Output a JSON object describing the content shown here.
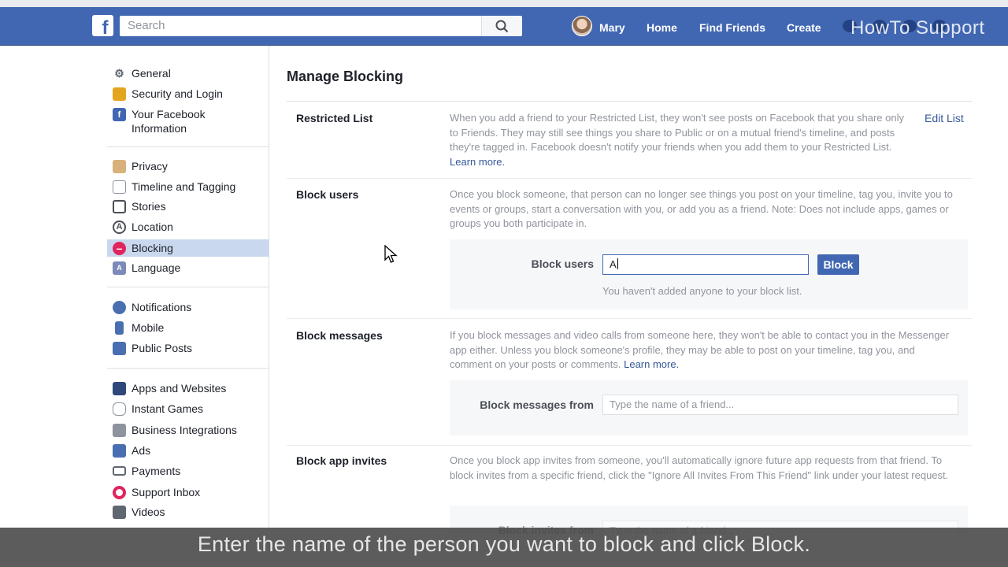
{
  "topnav": {
    "logo": "f",
    "search_placeholder": "Search",
    "user_name": "Mary",
    "links": [
      "Home",
      "Find Friends",
      "Create"
    ],
    "brand_color": "#4267b2"
  },
  "watermark": "HowTo Support",
  "sidebar": {
    "items": [
      {
        "label": "General",
        "icon": "gear-icon"
      },
      {
        "label": "Security and Login",
        "icon": "badge-icon"
      },
      {
        "label": "Your Facebook Information",
        "icon": "facebook-icon"
      },
      {
        "label": "Privacy",
        "icon": "lock-icon"
      },
      {
        "label": "Timeline and Tagging",
        "icon": "timeline-icon"
      },
      {
        "label": "Stories",
        "icon": "book-icon"
      },
      {
        "label": "Location",
        "icon": "location-icon"
      },
      {
        "label": "Blocking",
        "icon": "blocking-icon",
        "active": true
      },
      {
        "label": "Language",
        "icon": "language-icon"
      },
      {
        "label": "Notifications",
        "icon": "globe-icon"
      },
      {
        "label": "Mobile",
        "icon": "mobile-icon"
      },
      {
        "label": "Public Posts",
        "icon": "rss-icon"
      },
      {
        "label": "Apps and Websites",
        "icon": "apps-icon"
      },
      {
        "label": "Instant Games",
        "icon": "gamepad-icon"
      },
      {
        "label": "Business Integrations",
        "icon": "business-icon"
      },
      {
        "label": "Ads",
        "icon": "ads-icon"
      },
      {
        "label": "Payments",
        "icon": "card-icon"
      },
      {
        "label": "Support Inbox",
        "icon": "lifebuoy-icon"
      },
      {
        "label": "Videos",
        "icon": "film-icon"
      }
    ]
  },
  "main": {
    "title": "Manage Blocking",
    "restricted": {
      "label": "Restricted List",
      "desc": "When you add a friend to your Restricted List, they won't see posts on Facebook that you share only to Friends. They may still see things you share to Public or on a mutual friend's timeline, and posts they're tagged in. Facebook doesn't notify your friends when you add them to your Restricted List.",
      "learn_more": "Learn more.",
      "edit": "Edit List"
    },
    "block_users": {
      "label": "Block users",
      "desc": "Once you block someone, that person can no longer see things you post on your timeline, tag you, invite you to events or groups, start a conversation with you, or add you as a friend. Note: Does not include apps, games or groups you both participate in.",
      "field_label": "Block users",
      "input_value": "A",
      "button": "Block",
      "empty_note": "You haven't added anyone to your block list."
    },
    "block_messages": {
      "label": "Block messages",
      "desc": "If you block messages and video calls from someone here, they won't be able to contact you in the Messenger app either. Unless you block someone's profile, they may be able to post on your timeline, tag you, and comment on your posts or comments.",
      "learn_more": "Learn more.",
      "field_label": "Block messages from",
      "placeholder": "Type the name of a friend..."
    },
    "block_app_invites": {
      "label": "Block app invites",
      "desc": "Once you block app invites from someone, you'll automatically ignore future app requests from that friend. To block invites from a specific friend, click the \"Ignore All Invites From This Friend\" link under your latest request.",
      "field_label": "Block invites from",
      "placeholder": "Type the name of a friend..."
    }
  },
  "subtitle": "Enter the name of the person you want to block and click Block."
}
